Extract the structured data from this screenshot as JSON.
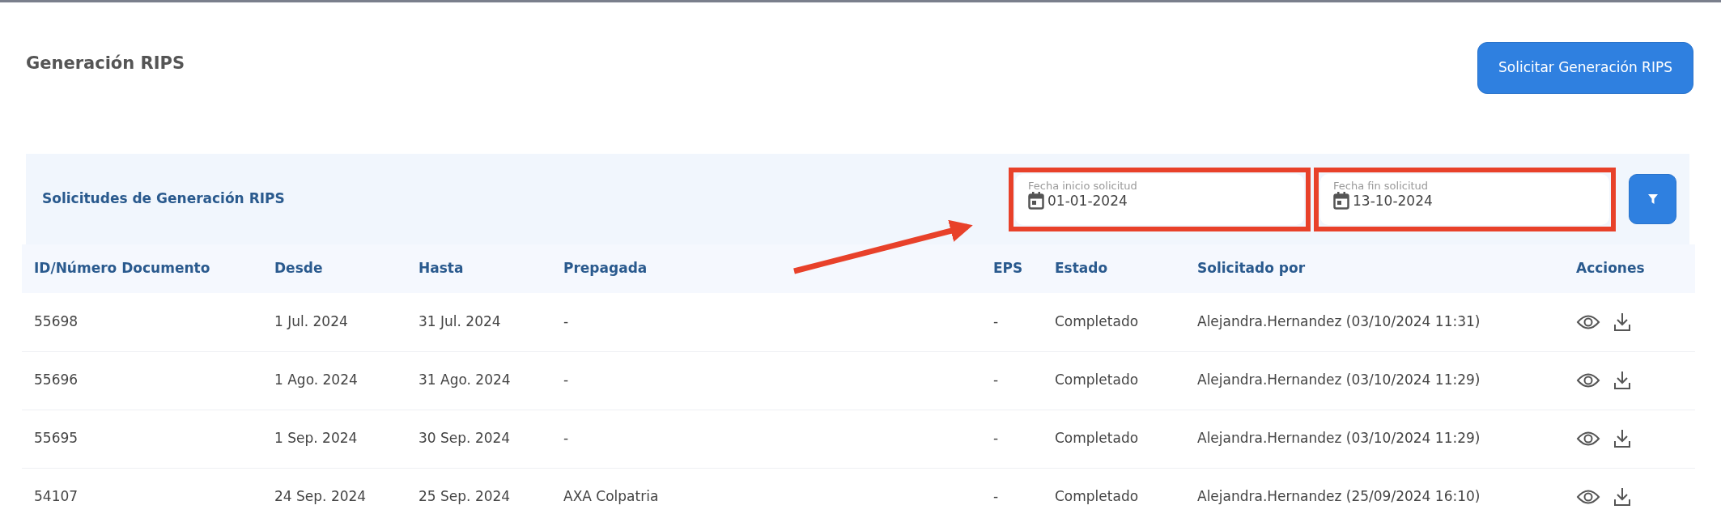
{
  "page_title": "Generación RIPS",
  "primary_button": "Solicitar Generación RIPS",
  "panel": {
    "title": "Solicitudes de Generación RIPS",
    "filters": [
      {
        "label": "Fecha inicio solicitud",
        "value": "01-01-2024",
        "highlighted": true
      },
      {
        "label": "Fecha fin solicitud",
        "value": "13-10-2024",
        "highlighted": true
      }
    ]
  },
  "table": {
    "columns": [
      "ID/Número Documento",
      "Desde",
      "Hasta",
      "Prepagada",
      "EPS",
      "Estado",
      "Solicitado por",
      "Acciones"
    ],
    "rows": [
      {
        "id": "55698",
        "desde": "1 Jul. 2024",
        "hasta": "31 Jul. 2024",
        "prepagada": "-",
        "eps": "-",
        "estado": "Completado",
        "solicitado_por": "Alejandra.Hernandez (03/10/2024 11:31)"
      },
      {
        "id": "55696",
        "desde": "1 Ago. 2024",
        "hasta": "31 Ago. 2024",
        "prepagada": "-",
        "eps": "-",
        "estado": "Completado",
        "solicitado_por": "Alejandra.Hernandez (03/10/2024 11:29)"
      },
      {
        "id": "55695",
        "desde": "1 Sep. 2024",
        "hasta": "30 Sep. 2024",
        "prepagada": "-",
        "eps": "-",
        "estado": "Completado",
        "solicitado_por": "Alejandra.Hernandez (03/10/2024 11:29)"
      },
      {
        "id": "54107",
        "desde": "24 Sep. 2024",
        "hasta": "25 Sep. 2024",
        "prepagada": "AXA Colpatria",
        "eps": "-",
        "estado": "Completado",
        "solicitado_por": "Alejandra.Hernandez (25/09/2024 16:10)"
      }
    ]
  }
}
